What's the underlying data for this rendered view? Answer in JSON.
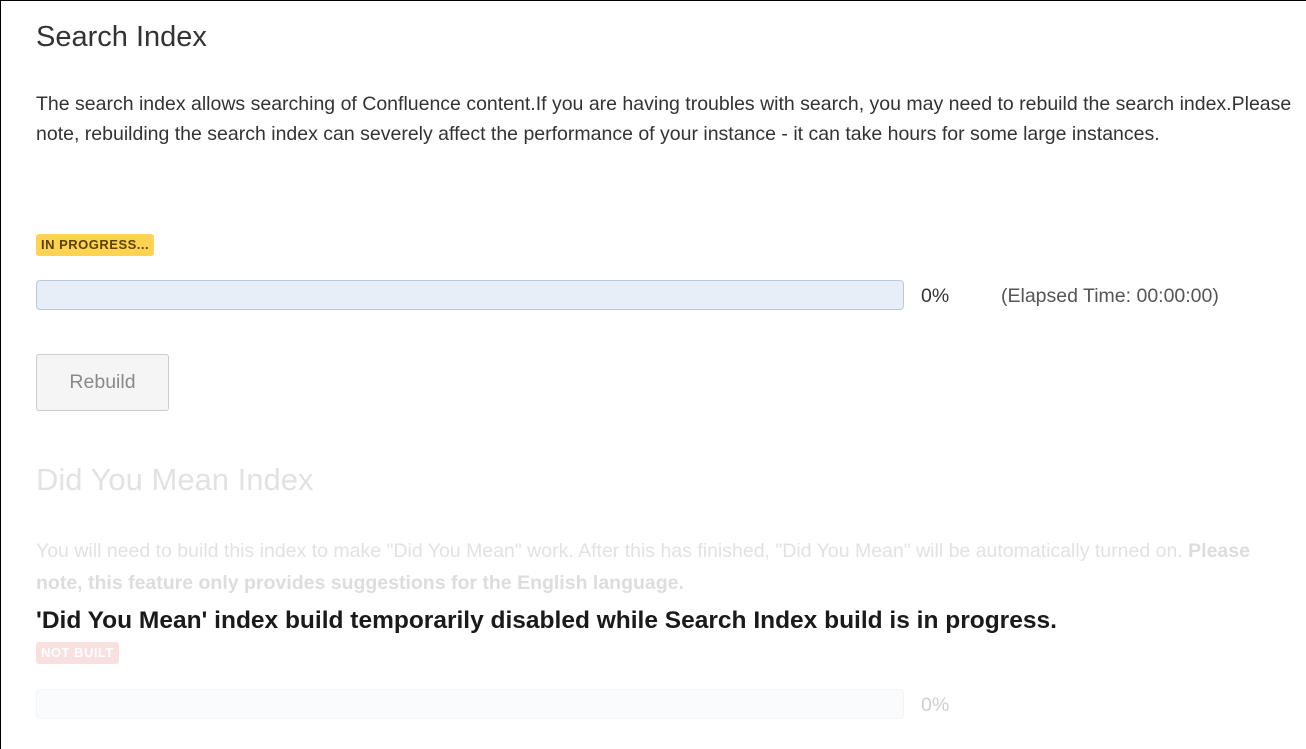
{
  "search_index": {
    "title": "Search Index",
    "description": "The search index allows searching of Confluence content.If you are having troubles with search, you may need to rebuild the search index.Please note, rebuilding the search index can severely affect the performance of your instance - it can take hours for some large instances.",
    "status": "IN PROGRESS...",
    "status_color": "#ffd351",
    "progress_fraction": 0,
    "percent_label": "0%",
    "elapsed_label": "(Elapsed Time: 00:00:00)",
    "rebuild_label": "Rebuild"
  },
  "did_you_mean_index": {
    "title": "Did You Mean Index",
    "description_intro": "You will need to build this index to make \"Did You Mean\" work. After this has finished, \"Did You Mean\" will be automatically turned on. ",
    "description_note": "Please note, this feature only provides suggestions for the English language.",
    "disabled_message": "'Did You Mean' index build temporarily disabled while Search Index build is in progress.",
    "status": "NOT BUILT",
    "status_color": "#d04437",
    "progress_fraction": 0,
    "percent_label": "0%"
  }
}
